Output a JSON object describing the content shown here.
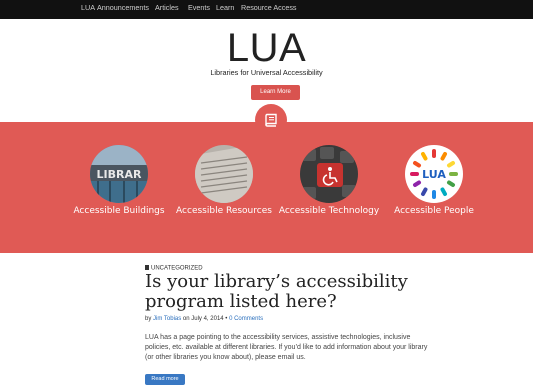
{
  "nav": {
    "items": [
      {
        "label": "LUA"
      },
      {
        "label": "Announcements"
      },
      {
        "label": "Articles"
      },
      {
        "label": "Events"
      },
      {
        "label": "Learn"
      },
      {
        "label": "Resource Access"
      }
    ]
  },
  "hero": {
    "title": "LUA",
    "tagline": "Libraries for Universal Accessibility",
    "learn_more": "Learn More",
    "badge_icon": "book-icon"
  },
  "features": [
    {
      "label": "Accessible Buildings",
      "icon": "library-building-photo"
    },
    {
      "label": "Accessible Resources",
      "icon": "braille-document-photo"
    },
    {
      "label": "Accessible Technology",
      "icon": "accessibility-keyboard-photo"
    },
    {
      "label": "Accessible People",
      "icon": "lua-logo",
      "logo_text": "LUA"
    }
  ],
  "post": {
    "category": "UNCATEGORIZED",
    "title": "Is your library’s accessibility program listed here?",
    "byline_by": "by ",
    "author": "Jim Tobias",
    "byline_on": " on July 4, 2014 • ",
    "comments": "0 Comments",
    "excerpt": "LUA has a page pointing to the accessibility services, assistive technologies, inclusive policies, etc. available at different libraries. If you’d like to add information about your library (or other libraries you know about), please email us.",
    "read_more": "Read more"
  },
  "colors": {
    "brand_red": "#e05a55",
    "button_red": "#d9534f",
    "nav_bg": "#111111",
    "link_blue": "#2a6fbd"
  }
}
